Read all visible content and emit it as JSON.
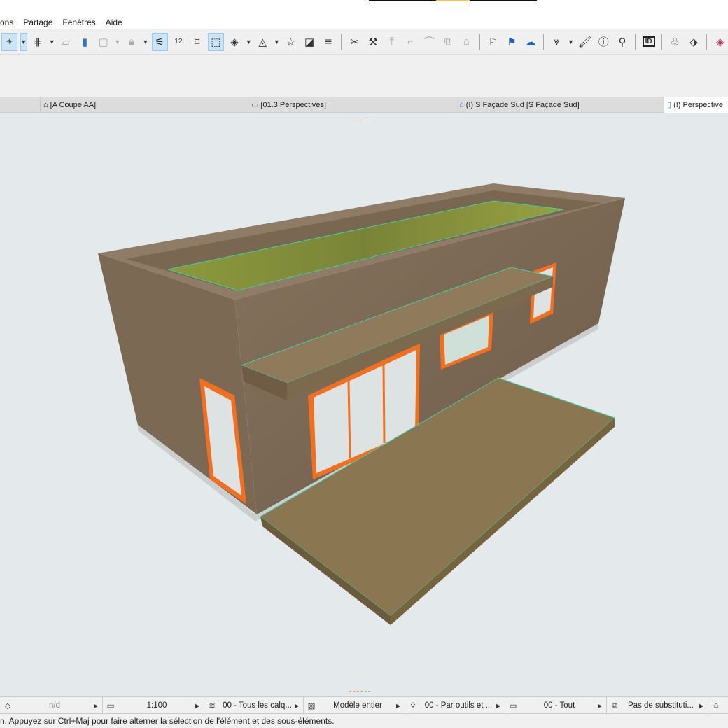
{
  "menu": [
    "ons",
    "Partage",
    "Fenêtres",
    "Aide"
  ],
  "toolbar": {
    "icons": [
      "coordinates-icon",
      "grid-snap-icon",
      "plane-icon",
      "wall-icon",
      "frame-icon",
      "lock-icon",
      "magic-wand-icon",
      "ruler-icon",
      "cross-icon",
      "selection-icon",
      "3d-box-icon",
      "shape-icon",
      "star-icon",
      "section-icon",
      "layers-icon",
      "split-icon",
      "hammer-icon",
      "elevate-icon",
      "corner-icon",
      "arc-icon",
      "offset-icon",
      "house-icon",
      "flag-icon",
      "flag-list-icon",
      "cloud-list-icon",
      "filter-icon",
      "paint-icon",
      "info-icon",
      "map-icon",
      "id-icon",
      "tree-icon",
      "tag-icon",
      "bim-icon"
    ],
    "id_label": "ID"
  },
  "tabs": [
    {
      "label": "[A Coupe AA]",
      "icon": "section-icon"
    },
    {
      "label": "[01.3 Perspectives]",
      "icon": "layout-icon"
    },
    {
      "label": "(!) S Façade Sud [S Façade Sud]",
      "icon": "elevation-icon"
    },
    {
      "label": "(!) Perspective",
      "icon": "3d-view-icon",
      "active": true
    }
  ],
  "status": {
    "na": "n/d",
    "scale": "1:100",
    "layers": "00 - Tous les calq...",
    "model": "Modèle entier",
    "pen": "00 - Par outils et ...",
    "view": "00 - Tout",
    "override": "Pas de substituti..."
  },
  "hint": "n. Appuyez sur Ctrl+Maj pour faire alterner la sélection de l'élément et des sous-éléments.",
  "colors": {
    "wall": "#7d6a56",
    "roof": "#7e8a3a",
    "deck": "#8a7650",
    "frame": "#f07020",
    "outline": "#40d0a0",
    "viewport": "#e4eaeb"
  }
}
